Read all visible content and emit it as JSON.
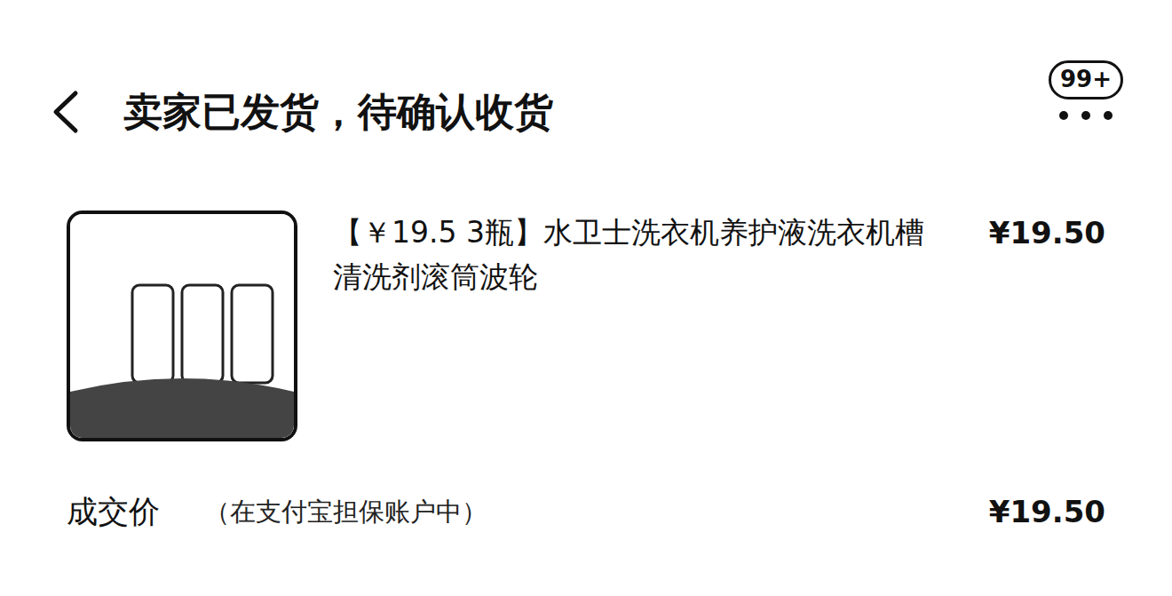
{
  "header": {
    "title": "卖家已发货，待确认收货",
    "badge": "99+"
  },
  "order_item": {
    "title": "【￥19.5 3瓶】水卫士洗衣机养护液洗衣机槽清洗剂滚筒波轮",
    "price": "¥19.50"
  },
  "deal": {
    "label": "成交价",
    "note": "（在支付宝担保账户中）",
    "price": "¥19.50"
  }
}
